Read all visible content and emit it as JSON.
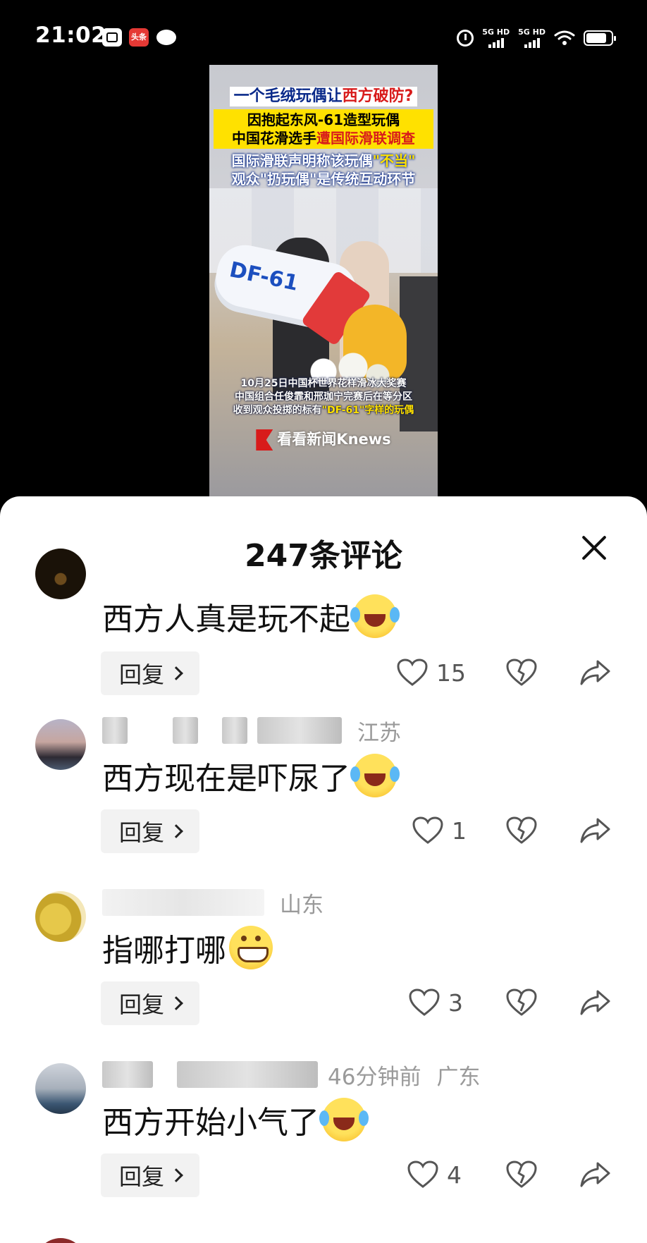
{
  "status_bar": {
    "time": "21:02",
    "notif_app2": "头条",
    "sim1_label": "5G HD",
    "sim2_label": "5G HD",
    "icons": [
      "screen-app-icon",
      "toutiao-icon",
      "chat-bubble-icon",
      "alarm-icon",
      "signal-icon",
      "signal-icon",
      "wifi-icon",
      "battery-icon"
    ]
  },
  "video": {
    "headline_prefix": "一个毛绒玩偶让",
    "headline_red": "西方破防?",
    "yellow_line1": "因抱起东风-61造型玩偶",
    "yellow_line2_prefix": "中国花滑选手",
    "yellow_line2_red": "遭国际滑联调查",
    "blue_line1_prefix": "国际滑联声明称该玩偶",
    "blue_line1_yellow": "\"不当\"",
    "blue_line2": "观众\"扔玩偶\"是传统互动环节",
    "plush_label": "DF-61",
    "caption_line1": "10月25日中国杯世界花样滑冰大奖赛",
    "caption_line2": "中国组合任俊霏和邢珈宁完赛后在等分区",
    "caption_line3_prefix": "收到观众投掷的标有",
    "caption_line3_yellow": "\"DF-61\"字样的玩偶",
    "source": "看看新闻Knews"
  },
  "sheet": {
    "title": "247条评论"
  },
  "comments": [
    {
      "location": "",
      "time_ago": "",
      "text": "西方人真是玩不起",
      "emoji": "loudly-crying-laughing-emoji",
      "reply_label": "回复",
      "likes": "15"
    },
    {
      "location": "江苏",
      "time_ago": "",
      "text": "西方现在是吓尿了",
      "emoji": "loudly-crying-laughing-emoji",
      "reply_label": "回复",
      "likes": "1"
    },
    {
      "location": "山东",
      "time_ago": "",
      "text": "指哪打哪",
      "emoji": "grinning-emoji",
      "reply_label": "回复",
      "likes": "3"
    },
    {
      "location": "广东",
      "time_ago": "46分钟前",
      "text": "西方开始小气了",
      "emoji": "loudly-crying-laughing-emoji",
      "reply_label": "回复",
      "likes": "4"
    }
  ]
}
